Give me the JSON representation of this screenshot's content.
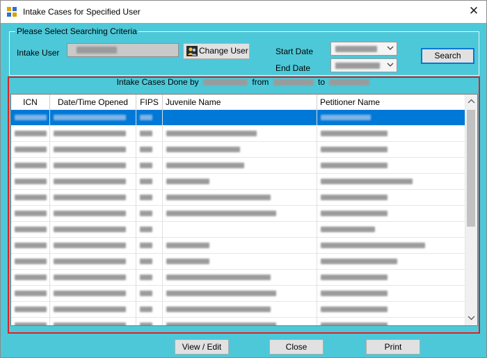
{
  "window": {
    "title": "Intake Cases for Specified User",
    "close_glyph": "✕"
  },
  "criteria": {
    "legend": "Please Select Searching Criteria",
    "intake_user_label": "Intake User",
    "change_user_label": "Change User",
    "start_date_label": "Start Date",
    "end_date_label": "End Date",
    "search_label": "Search"
  },
  "caption": {
    "prefix": "Intake Cases Done by",
    "from": "from",
    "to": "to"
  },
  "grid": {
    "columns": [
      "ICN",
      "Date/Time Opened",
      "FIPS",
      "Juvenile Name",
      "Petitioner Name"
    ],
    "row_count": 14,
    "selected_row_index": 0
  },
  "buttons": {
    "view_edit": "View / Edit",
    "close": "Close",
    "print": "Print"
  },
  "colors": {
    "window_bg": "#4dc8d8",
    "selection": "#0078d7",
    "highlight_frame": "#e02020"
  }
}
